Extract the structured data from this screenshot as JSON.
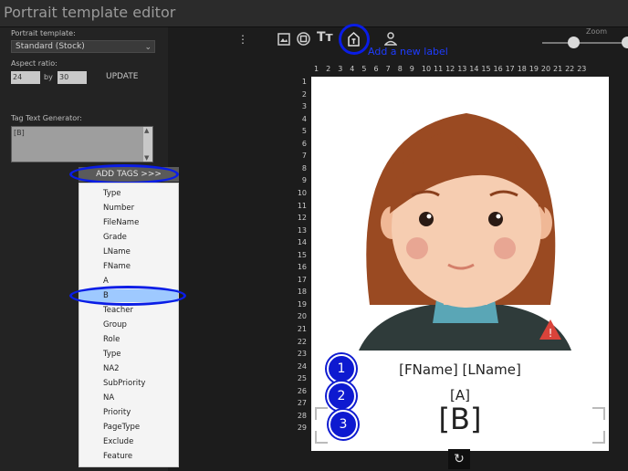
{
  "window": {
    "title": "Portrait template editor"
  },
  "sidebar": {
    "template_label": "Portrait template:",
    "template_value": "Standard (Stock)",
    "aspect_label": "Aspect ratio:",
    "aspect_w": "24",
    "by_label": "by",
    "aspect_h": "30",
    "update_label": "UPDATE",
    "generator_label": "Tag Text Generator:",
    "generator_value": "[B]",
    "add_tags_label": "ADD TAGS >>>"
  },
  "tags_menu": {
    "items": [
      "Type",
      "Number",
      "FileName",
      "Grade",
      "LName",
      "FName",
      "A",
      "B",
      "Teacher",
      "Group",
      "Role",
      "Type",
      "NA2",
      "SubPriority",
      "NA",
      "Priority",
      "PageType",
      "Exclude",
      "Feature"
    ],
    "selected": "B"
  },
  "toolbar": {
    "annotation": "Add a new label",
    "zoom_label": "Zoom"
  },
  "rulers": {
    "top": [
      "1",
      "2",
      "3",
      "4",
      "5",
      "6",
      "7",
      "8",
      "9",
      "10",
      "11",
      "12",
      "13",
      "14",
      "15",
      "16",
      "17",
      "18",
      "19",
      "20",
      "21",
      "22",
      "23"
    ],
    "left": [
      "1",
      "2",
      "3",
      "4",
      "5",
      "6",
      "7",
      "8",
      "9",
      "10",
      "11",
      "12",
      "13",
      "14",
      "15",
      "16",
      "17",
      "18",
      "19",
      "20",
      "21",
      "22",
      "23",
      "24",
      "25",
      "26",
      "27",
      "28",
      "29"
    ]
  },
  "canvas": {
    "caption1": "[FName] [LName]",
    "caption2": "[A]",
    "caption3": "[B]"
  },
  "badges": [
    "1",
    "2",
    "3"
  ],
  "colors": {
    "highlight": "#0a1de6",
    "selection": "#9ec9ff"
  }
}
